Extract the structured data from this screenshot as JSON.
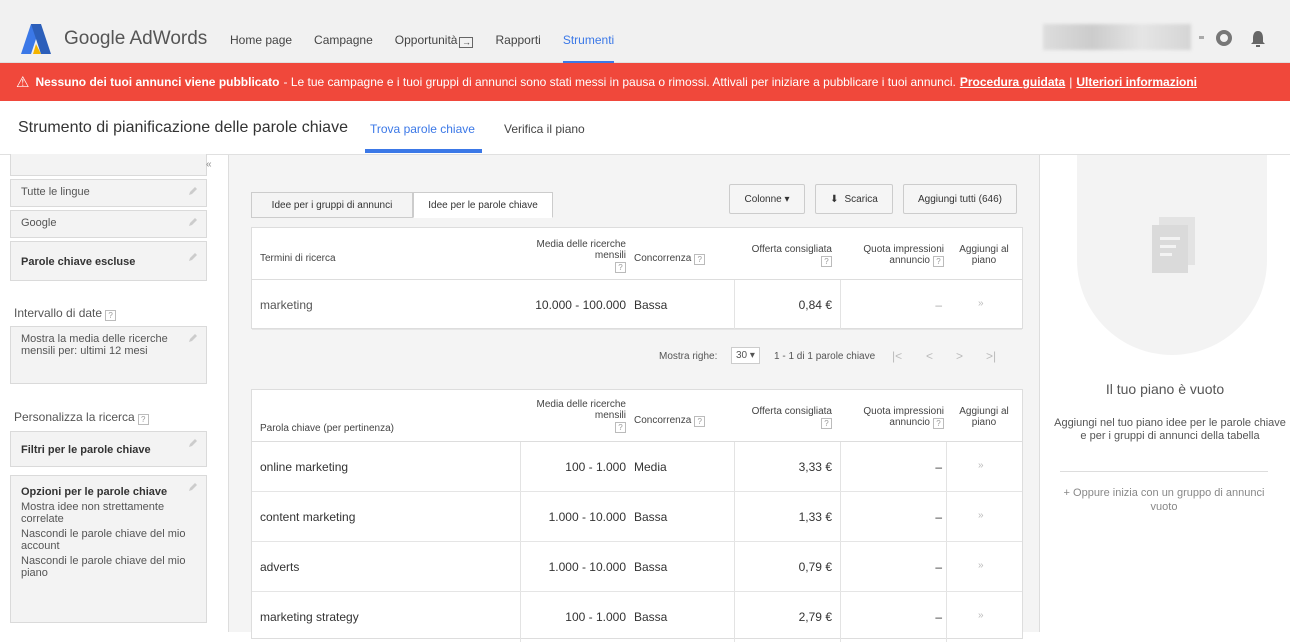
{
  "app": {
    "brand": "Google AdWords",
    "nav": [
      {
        "label": "Home page"
      },
      {
        "label": "Campagne"
      },
      {
        "label": "Opportunità"
      },
      {
        "label": "Rapporti"
      },
      {
        "label": "Strumenti"
      }
    ]
  },
  "alert": {
    "warning_icon": "⚠",
    "bold_text": "Nessuno dei tuoi annunci viene pubblicato",
    "text": "- Le tue campagne e i tuoi gruppi di annunci sono stati messi in pausa o rimossi. Attivali per iniziare a pubblicare i tuoi annunci.",
    "link1": "Procedura guidata",
    "sep": "|",
    "link2": "Ulteriori informazioni"
  },
  "subheader": {
    "title": "Strumento di pianificazione delle parole chiave",
    "tab1": "Trova parole chiave",
    "tab2": "Verifica il piano"
  },
  "sidebar": {
    "collapse": "«",
    "languages": "Tutte le lingue",
    "network": "Google",
    "negative_keywords": "Parole chiave escluse",
    "date_label": "Intervallo di date",
    "date_value": "Mostra la media delle ricerche mensili per: ultimi 12 mesi",
    "customize_label": "Personalizza la ricerca",
    "filters": "Filtri per le parole chiave",
    "options_title": "Opzioni per le parole chiave",
    "option1": "Mostra idee non strettamente correlate",
    "option2": "Nascondi le parole chiave del mio account",
    "option3": "Nascondi le parole chiave del mio piano",
    "qm": "?"
  },
  "main": {
    "tab_groups": "Idee per i gruppi di annunci",
    "tab_keywords": "Idee per le parole chiave",
    "columns_btn": "Colonne ▾",
    "download_btn": "Scarica",
    "download_icon": "⬇",
    "add_all_btn": "Aggiungi tutti (646)",
    "table1": {
      "col1": "Termini di ricerca",
      "col2": "Media delle ricerche mensili",
      "col3": "Concorrenza",
      "col4": "Offerta consigliata",
      "col5": "Quota impressioni annuncio",
      "col6": "Aggiungi al piano",
      "rows": [
        {
          "term": "marketing",
          "searches": "10.000 - 100.000",
          "competition": "Bassa",
          "bid": "0,84 €",
          "share": "–",
          "add": "»"
        }
      ]
    },
    "pager": {
      "label": "Mostra righe:",
      "rows": "30",
      "range": "1 - 1 di 1 parole chiave",
      "first": "|<",
      "prev": "<",
      "next": ">",
      "last": ">|"
    },
    "table2": {
      "col1": "Parola chiave (per pertinenza)",
      "col2": "Media delle ricerche mensili",
      "col3": "Concorrenza",
      "col4": "Offerta consigliata",
      "col5": "Quota impressioni annuncio",
      "col6": "Aggiungi al piano",
      "rows": [
        {
          "term": "online marketing",
          "searches": "100 - 1.000",
          "competition": "Media",
          "bid": "3,33 €",
          "share": "–",
          "add": "»"
        },
        {
          "term": "content marketing",
          "searches": "1.000 - 10.000",
          "competition": "Bassa",
          "bid": "1,33 €",
          "share": "–",
          "add": "»"
        },
        {
          "term": "adverts",
          "searches": "1.000 - 10.000",
          "competition": "Bassa",
          "bid": "0,79 €",
          "share": "–",
          "add": "»"
        },
        {
          "term": "marketing strategy",
          "searches": "100 - 1.000",
          "competition": "Bassa",
          "bid": "2,79 €",
          "share": "–",
          "add": "»"
        }
      ]
    }
  },
  "plan": {
    "title": "Il tuo piano è vuoto",
    "desc": "Aggiungi nel tuo piano idee per le parole chiave e per i gruppi di annunci della tabella",
    "alt": "+ Oppure inizia con un gruppo di annunci vuoto"
  },
  "colors": {
    "accent": "#3b78e7",
    "alert": "#f0483b"
  }
}
